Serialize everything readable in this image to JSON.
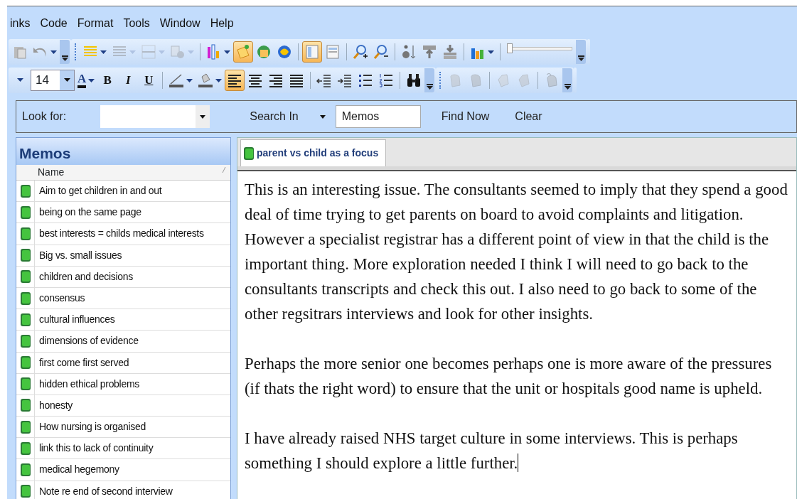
{
  "menu": [
    {
      "label": "inks"
    },
    {
      "label": "Code"
    },
    {
      "label": "Format"
    },
    {
      "label": "Tools"
    },
    {
      "label": "Window"
    },
    {
      "label": "Help"
    }
  ],
  "toolbar_1": [
    {
      "kind": "button",
      "pressed": false,
      "disabled": false
    },
    {
      "kind": "button",
      "pressed": false,
      "disabled": false,
      "dropdown": true
    },
    {
      "kind": "overflow"
    },
    {
      "kind": "grip"
    },
    {
      "kind": "button",
      "pressed": false,
      "disabled": false,
      "dropdown": true
    },
    {
      "kind": "button",
      "pressed": false,
      "disabled": true,
      "dropdown": true
    },
    {
      "kind": "button",
      "pressed": false,
      "disabled": true,
      "dropdown": true
    },
    {
      "kind": "button",
      "pressed": false,
      "disabled": true,
      "dropdown": true
    },
    {
      "kind": "sep"
    },
    {
      "kind": "button",
      "pressed": false,
      "disabled": false,
      "dropdown": true
    },
    {
      "kind": "button",
      "pressed": true,
      "disabled": false
    },
    {
      "kind": "button",
      "pressed": false,
      "disabled": false
    },
    {
      "kind": "button",
      "pressed": false,
      "disabled": false
    },
    {
      "kind": "sep"
    },
    {
      "kind": "button",
      "pressed": true,
      "disabled": false
    },
    {
      "kind": "button",
      "pressed": false,
      "disabled": false
    },
    {
      "kind": "sep"
    },
    {
      "kind": "button",
      "pressed": false,
      "disabled": false
    },
    {
      "kind": "button",
      "pressed": false,
      "disabled": false
    },
    {
      "kind": "sep"
    },
    {
      "kind": "button",
      "pressed": false,
      "disabled": false
    },
    {
      "kind": "button",
      "pressed": false,
      "disabled": false
    },
    {
      "kind": "button",
      "pressed": false,
      "disabled": false
    },
    {
      "kind": "sep"
    },
    {
      "kind": "button",
      "pressed": false,
      "disabled": false,
      "dropdown": true
    },
    {
      "kind": "sep"
    },
    {
      "kind": "slider",
      "level": 0.03
    },
    {
      "kind": "overflow"
    }
  ],
  "toolbar_2": [
    {
      "kind": "caret"
    },
    {
      "kind": "size",
      "value": "14"
    },
    {
      "kind": "button",
      "label": "A",
      "pressed": false,
      "disabled": false,
      "dropdown": true
    },
    {
      "kind": "button",
      "label": "B",
      "pressed": false,
      "disabled": false
    },
    {
      "kind": "button",
      "label": "I",
      "pressed": false,
      "disabled": false
    },
    {
      "kind": "button",
      "label": "U",
      "pressed": false,
      "disabled": false
    },
    {
      "kind": "sep"
    },
    {
      "kind": "button",
      "pressed": false,
      "disabled": false,
      "dropdown": true
    },
    {
      "kind": "button",
      "pressed": false,
      "disabled": false,
      "dropdown": true
    },
    {
      "kind": "button",
      "pressed": true,
      "disabled": false
    },
    {
      "kind": "button",
      "pressed": false,
      "disabled": false
    },
    {
      "kind": "button",
      "pressed": false,
      "disabled": false
    },
    {
      "kind": "button",
      "pressed": false,
      "disabled": false
    },
    {
      "kind": "sep"
    },
    {
      "kind": "button",
      "pressed": false,
      "disabled": false
    },
    {
      "kind": "button",
      "pressed": false,
      "disabled": false
    },
    {
      "kind": "button",
      "pressed": false,
      "disabled": false
    },
    {
      "kind": "button",
      "pressed": false,
      "disabled": false
    },
    {
      "kind": "sep"
    },
    {
      "kind": "button",
      "pressed": false,
      "disabled": false
    },
    {
      "kind": "overflow"
    },
    {
      "kind": "grip"
    },
    {
      "kind": "button",
      "pressed": false,
      "disabled": true
    },
    {
      "kind": "button",
      "pressed": false,
      "disabled": true
    },
    {
      "kind": "sep"
    },
    {
      "kind": "button",
      "pressed": false,
      "disabled": true
    },
    {
      "kind": "button",
      "pressed": false,
      "disabled": true
    },
    {
      "kind": "sep"
    },
    {
      "kind": "button",
      "pressed": false,
      "disabled": true
    },
    {
      "kind": "overflow"
    }
  ],
  "search_bar": {
    "look_for_label": "Look for:",
    "search_in_label": "Search In",
    "search_in_value": "Memos",
    "find_button": "Find Now",
    "clear_button": "Clear"
  },
  "memos_panel": {
    "title": "Memos",
    "column": "Name",
    "rows": [
      {
        "name": "Aim to get children in and out"
      },
      {
        "name": "being on the same page"
      },
      {
        "name": "best interests = childs medical interests"
      },
      {
        "name": "Big vs. small issues"
      },
      {
        "name": "children and decisions"
      },
      {
        "name": "consensus"
      },
      {
        "name": "cultural influences"
      },
      {
        "name": "dimensions of evidence"
      },
      {
        "name": "first come first served"
      },
      {
        "name": "hidden ethical problems"
      },
      {
        "name": "honesty"
      },
      {
        "name": "How nursing is organised"
      },
      {
        "name": "link this to lack of continuity"
      },
      {
        "name": "medical hegemony"
      },
      {
        "name": "Note re end of second interview"
      }
    ]
  },
  "document": {
    "tabs": [
      {
        "label": "parent vs child as a focus",
        "selected": true
      }
    ],
    "paragraphs": [
      "This is an interesting issue. The consultants seemed to imply that they spend a good deal of time trying to get parents on board to avoid complaints and litigation. However a specialist registrar has a different point of view in that the child is the important thing.  More exploration needed I think I will need to go back to the consultants transcripts and check this out. I also need to go back to some of the other regsitrars interviews and look for other insights.",
      "Perhaps the more senior one becomes perhaps one is more aware of the pressures (if thats the right word) to ensure that the unit or hospitals good name is upheld.",
      "I have already raised NHS target culture in some interviews. This is perhaps something I should explore a little further."
    ]
  }
}
